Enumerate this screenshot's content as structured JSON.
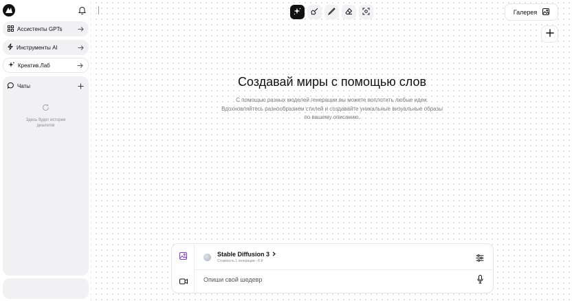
{
  "sidebar": {
    "logo_icon": "brand-logo-icon",
    "notifications_icon": "bell-icon",
    "items": [
      {
        "label": "Ассистенты GPTs",
        "icon": "grid-icon"
      },
      {
        "label": "Инструменты AI",
        "icon": "lightning-icon"
      },
      {
        "label": "Креатив.Лаб",
        "icon": "sparkles-icon"
      }
    ],
    "chats": {
      "label": "Чаты",
      "icon": "chat-bubble-icon",
      "add_icon": "plus-icon",
      "empty_icon": "refresh-icon",
      "empty_text": "Здесь будет история диалогов"
    }
  },
  "toolbar": {
    "tools": [
      {
        "name": "generate-tool",
        "icon": "sparkles-icon",
        "active": true
      },
      {
        "name": "brush-tool",
        "icon": "brush-icon",
        "active": false
      },
      {
        "name": "pen-tool",
        "icon": "pen-icon",
        "active": false
      },
      {
        "name": "eraser-tool",
        "icon": "eraser-icon",
        "active": false
      },
      {
        "name": "scan-tool",
        "icon": "scan-icon",
        "active": false
      }
    ]
  },
  "header": {
    "gallery_label": "Галерея",
    "gallery_icon": "image-icon",
    "add_icon": "plus-icon"
  },
  "hero": {
    "title": "Создавай миры с помощью слов",
    "description": "С помощью разных моделей генерации вы можете воплотить любые идеи. Вдохновляйтесь разнообразием стилей и создавайте уникальные визуальные образы по вашему описанию."
  },
  "composer": {
    "mode_image_icon": "image-icon",
    "mode_video_icon": "video-camera-icon",
    "model_name": "Stable Diffusion 3",
    "model_cost": "Стоимость 1 генерации - 8 ₽",
    "settings_icon": "sliders-icon",
    "prompt_placeholder": "Опиши свой шедевр",
    "prompt_value": "",
    "mic_icon": "microphone-icon"
  },
  "colors": {
    "accent": "#7c3aed",
    "active_tool_bg": "#111111",
    "panel_bg": "#f1f1f3"
  }
}
